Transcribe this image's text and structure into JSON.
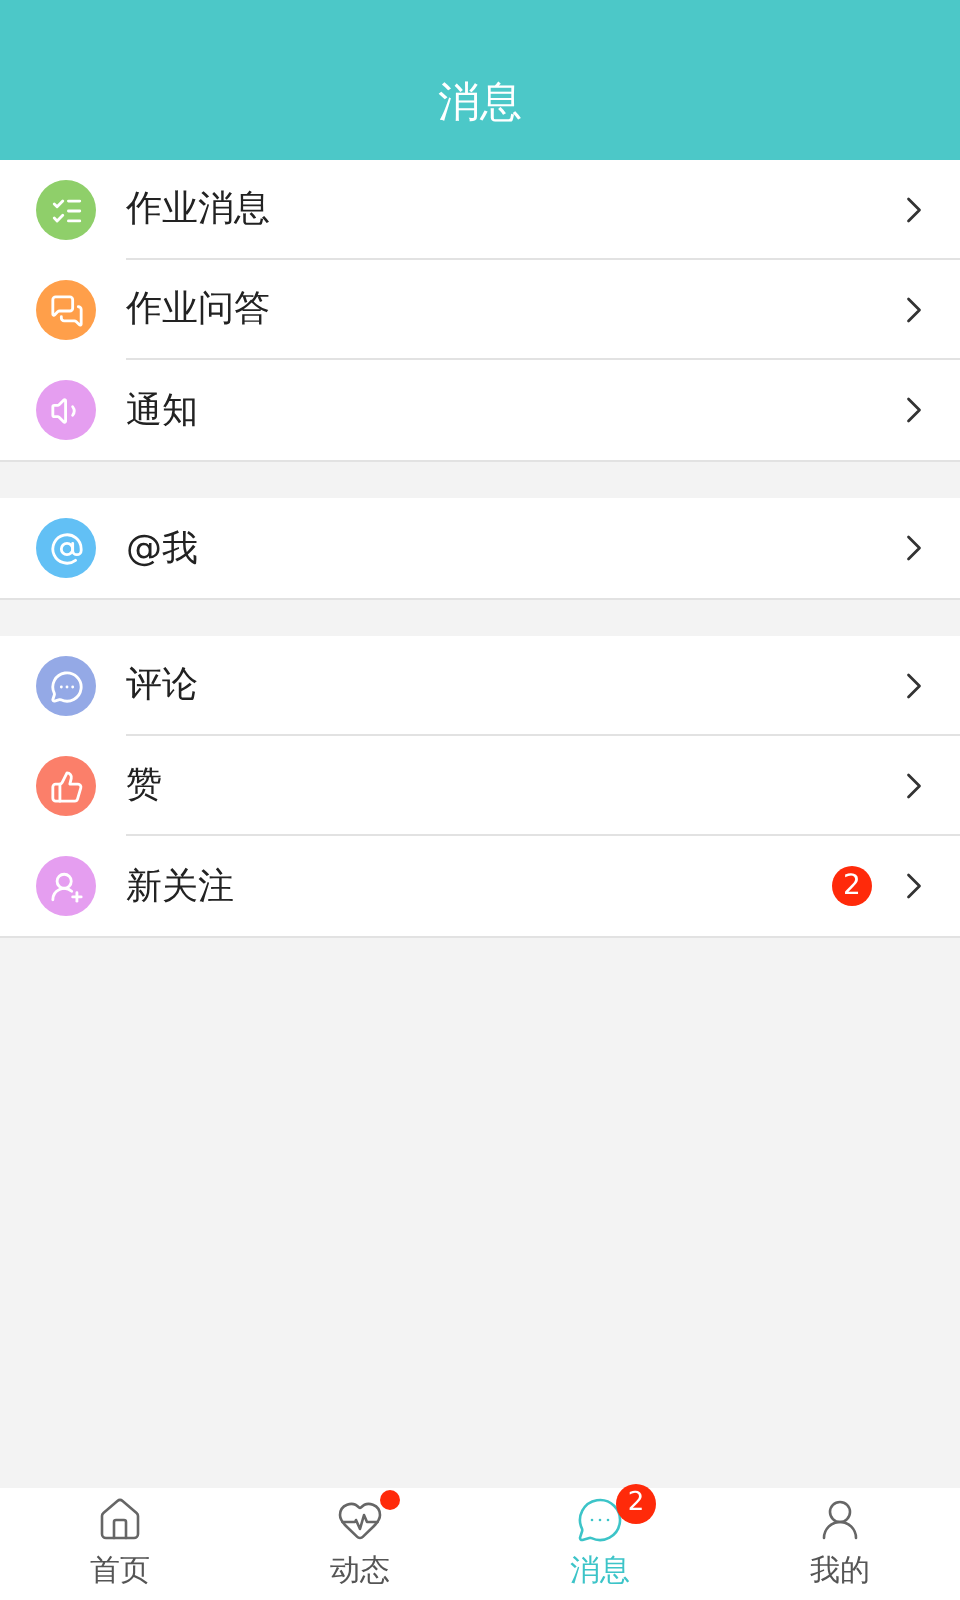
{
  "title": "消息",
  "groups": [
    {
      "items": [
        {
          "label": "作业消息",
          "color": "#8fcf6a"
        },
        {
          "label": "作业问答",
          "color": "#ff9f4a"
        },
        {
          "label": "通知",
          "color": "#e59ef0"
        }
      ]
    },
    {
      "items": [
        {
          "label": "@我",
          "color": "#62c0f5"
        }
      ]
    },
    {
      "items": [
        {
          "label": "评论",
          "color": "#94a9e6"
        },
        {
          "label": "赞",
          "color": "#fb7f6a"
        },
        {
          "label": "新关注",
          "color": "#e59ef0",
          "badge": "2"
        }
      ]
    }
  ],
  "tabs": [
    {
      "label": "首页",
      "selected": false
    },
    {
      "label": "动态",
      "selected": false,
      "dot": true
    },
    {
      "label": "消息",
      "selected": true,
      "badge": "2"
    },
    {
      "label": "我的",
      "selected": false
    }
  ]
}
